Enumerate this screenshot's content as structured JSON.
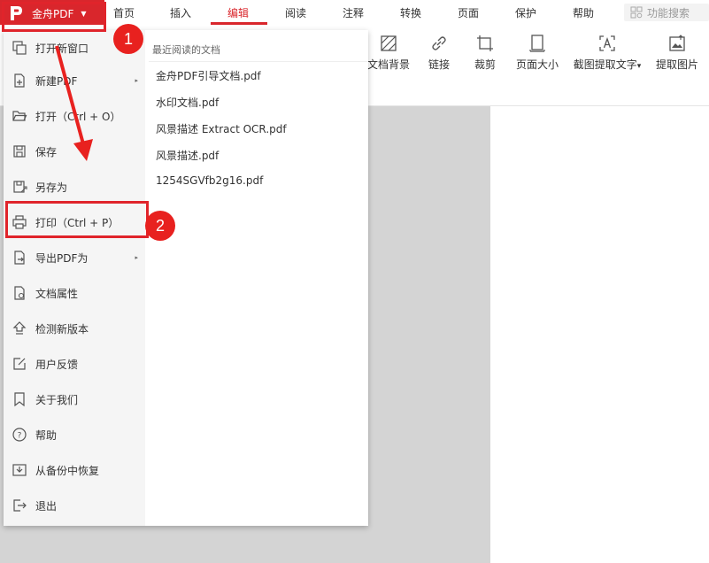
{
  "brand": {
    "name": "金舟PDF",
    "accent": "#d9262c"
  },
  "menu_tabs": [
    {
      "label": "首页",
      "active": false
    },
    {
      "label": "插入",
      "active": false
    },
    {
      "label": "编辑",
      "active": true
    },
    {
      "label": "阅读",
      "active": false
    },
    {
      "label": "注释",
      "active": false
    },
    {
      "label": "转换",
      "active": false
    },
    {
      "label": "页面",
      "active": false
    },
    {
      "label": "保护",
      "active": false
    },
    {
      "label": "帮助",
      "active": false
    }
  ],
  "search": {
    "label": "功能搜索",
    "icon": "search-icon"
  },
  "toolbar": [
    {
      "label": "文档背景",
      "icon": "background-icon"
    },
    {
      "label": "链接",
      "icon": "link-icon"
    },
    {
      "label": "裁剪",
      "icon": "crop-icon"
    },
    {
      "label": "页面大小",
      "icon": "page-size-icon"
    },
    {
      "label": "截图提取文字",
      "icon": "ocr-icon",
      "dropdown": true,
      "caret": "▾"
    },
    {
      "label": "提取图片",
      "icon": "extract-image-icon"
    }
  ],
  "file_menu": {
    "items": [
      {
        "label": "打开新窗口",
        "icon": "new-window-icon"
      },
      {
        "label": "新建PDF",
        "icon": "new-file-icon",
        "submenu": true,
        "arrow": "▸"
      },
      {
        "label": "打开（Ctrl + O）",
        "icon": "folder-open-icon"
      },
      {
        "label": "保存",
        "icon": "save-icon"
      },
      {
        "label": "另存为",
        "icon": "save-as-icon",
        "highlighted": true
      },
      {
        "label": "打印（Ctrl + P）",
        "icon": "print-icon"
      },
      {
        "label": "导出PDF为",
        "icon": "export-icon",
        "submenu": true,
        "arrow": "▸"
      },
      {
        "label": "文档属性",
        "icon": "doc-properties-icon"
      },
      {
        "label": "检测新版本",
        "icon": "update-icon"
      },
      {
        "label": "用户反馈",
        "icon": "feedback-icon"
      },
      {
        "label": "关于我们",
        "icon": "about-icon"
      },
      {
        "label": "帮助",
        "icon": "help-icon"
      },
      {
        "label": "从备份中恢复",
        "icon": "restore-icon"
      },
      {
        "label": "退出",
        "icon": "exit-icon"
      }
    ]
  },
  "recent": {
    "title": "最近阅读的文档",
    "files": [
      "金舟PDF引导文档.pdf",
      "水印文档.pdf",
      "风景描述 Extract OCR.pdf",
      "风景描述.pdf",
      "1254SGVfb2g16.pdf"
    ]
  },
  "annotations": {
    "step1": "1",
    "step2": "2",
    "color": "#e8211f"
  }
}
